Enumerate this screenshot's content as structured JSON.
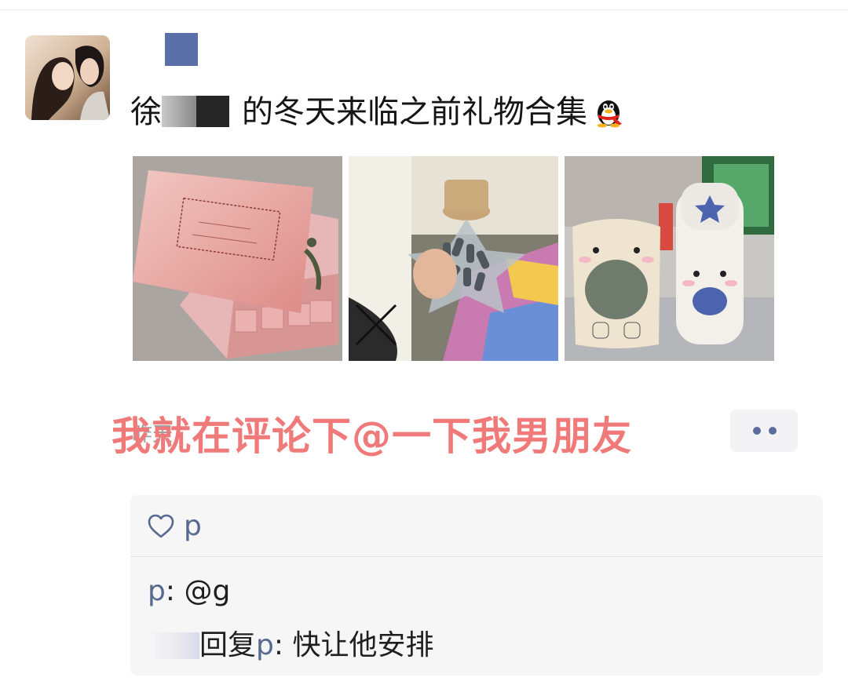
{
  "post": {
    "title_prefix": "徐",
    "title_suffix": "的冬天来临之前礼物合集",
    "time": "昨天"
  },
  "overlay_caption": "我就在评论下@一下我男朋友",
  "more_button_icon": "more-dots-icon",
  "likes": {
    "icon": "heart-outline-icon",
    "names": "p"
  },
  "comments": [
    {
      "author": "p",
      "separator": ": ",
      "text": "@g"
    },
    {
      "author_hidden": "",
      "reply_word": "回复",
      "reply_to": "p",
      "separator": ": ",
      "text": "快让他安排"
    }
  ],
  "colors": {
    "link_blue": "#56698f",
    "overlay_pink": "#f07a7a",
    "panel_bg": "#f6f6f7"
  }
}
